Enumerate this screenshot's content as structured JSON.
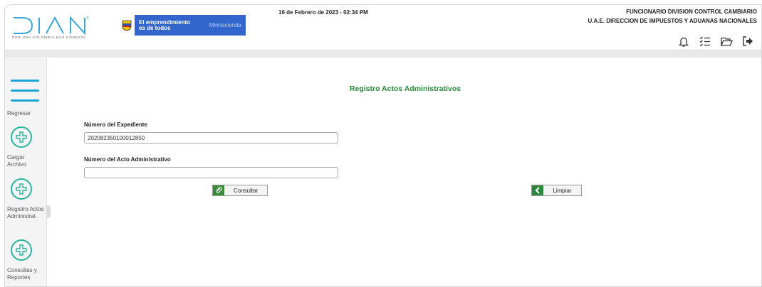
{
  "header": {
    "logo_text": "DIAN",
    "logo_tagline": "POR UNA COLOMBIA MÁS HONESTA",
    "gov_banner_line1": "El emprendimiento",
    "gov_banner_line2": "es de todos",
    "gov_banner_ministry": "Minhacienda",
    "datetime": "16 de Febrero de 2023 - 02:34 PM",
    "user_role": "FUNCIONARIO DIVISION CONTROL CAMBIARIO",
    "user_entity": "U.A.E. DIRECCION DE IMPUESTOS Y ADUANAS NACIONALES",
    "icons": [
      "bell-icon",
      "checklist-icon",
      "folder-open-icon",
      "logout-icon"
    ]
  },
  "sidebar": {
    "back_label": "Regresar",
    "items": [
      {
        "label": "Cargar Archivo"
      },
      {
        "label": "Registro Actos Administrat"
      },
      {
        "label": "Consultas y Reportes"
      }
    ]
  },
  "main": {
    "title": "Registro Actos Administrativos",
    "expediente_label": "Número del Expediente",
    "expediente_value": "202082350100012850",
    "acto_label": "Número del Acto Administrativo",
    "acto_value": "",
    "consultar_label": "Consultar",
    "limpiar_label": "Limpiar"
  },
  "colors": {
    "accent_green": "#2a8a3a",
    "menu_blue": "#1aa5d8",
    "circle_teal": "#28b5a0",
    "gov_blue": "#3366cc"
  }
}
